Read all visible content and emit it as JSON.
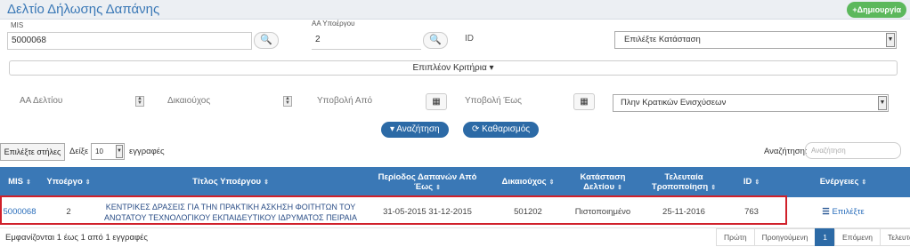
{
  "header": {
    "title": "Δελτίο Δήλωσης Δαπάνης",
    "create_label": "+Δημιουργία"
  },
  "filters": {
    "mis_label": "MIS",
    "mis_value": "5000068",
    "aa_label": "ΑΑ Υποέργου",
    "aa_value": "2",
    "id_label": "ID",
    "status_placeholder": "Επιλέξτε Κατάσταση",
    "more_criteria": "Επιπλέον Κριτήρια ▾",
    "aa_deltiou": "ΑΑ Δελτίου",
    "dikaiouxos": "Δικαιούχος",
    "ypovoli_apo": "Υποβολή Από",
    "ypovoli_eos": "Υποβολή Έως",
    "kratikes": "Πλην Κρατικών Ενισχύσεων",
    "search_btn": "Αναζήτηση",
    "clear_btn": "Καθαρισμός"
  },
  "table_controls": {
    "columns_btn": "Επιλέξτε στήλες",
    "show_label": "Δείξε",
    "page_len": "10",
    "records_label": "εγγραφές",
    "search_label": "Αναζήτηση:",
    "search_placeholder": "Αναζήτηση"
  },
  "columns": [
    "MIS",
    "Υποέργο",
    "Τίτλος Υποέργου",
    "Περίοδος Δαπανών Από Έως",
    "Δικαιούχος",
    "Κατάσταση Δελτίου",
    "Τελευταία Τροποποίηση",
    "ID",
    "Ενέργειες"
  ],
  "row": {
    "mis": "5000068",
    "ypoergo": "2",
    "title_line1": "ΚΕΝΤΡΙΚΕΣ ΔΡΑΣΕΙΣ ΓΙΑ ΤΗΝ ΠΡΑΚΤΙΚΗ ΑΣΚΗΣΗ ΦΟΙΤΗΤΩΝ ΤΟΥ",
    "title_line2": "ΑΝΩΤΑΤΟΥ ΤΕΧΝΟΛΟΓΙΚΟΥ ΕΚΠΑΙΔΕΥΤΙΚΟΥ ΙΔΡΥΜΑΤΟΣ ΠΕΙΡΑΙΑ",
    "period": "31-05-2015 31-12-2015",
    "dikaiouxos": "501202",
    "status": "Πιστοποιημένο",
    "modified": "25-11-2016",
    "id": "763",
    "action": "Επιλέξτε"
  },
  "footer": {
    "info": "Εμφανίζονται 1 έως 1 από 1 εγγραφές",
    "first": "Πρώτη",
    "prev": "Προηγούμενη",
    "page": "1",
    "next": "Επόμενη",
    "last": "Τελευταία"
  }
}
